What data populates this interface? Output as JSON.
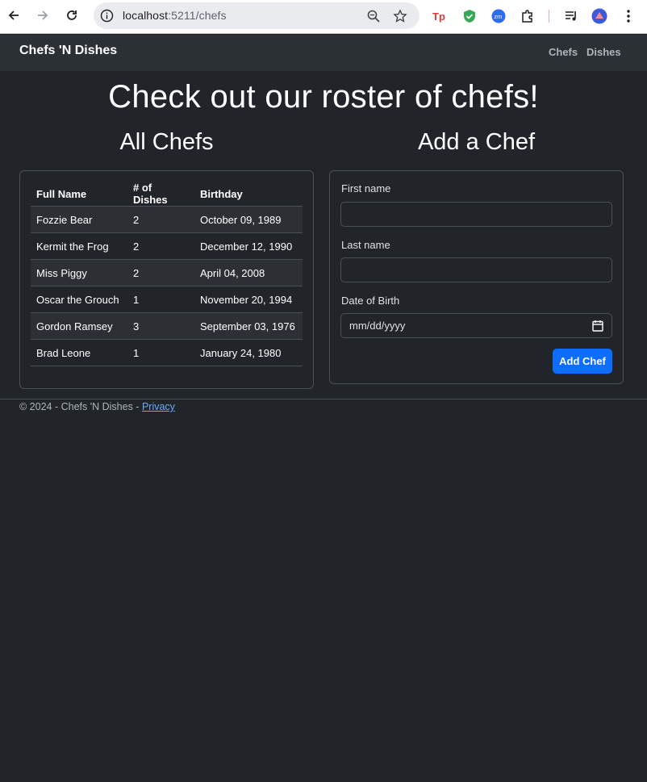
{
  "browser": {
    "url_host": "localhost",
    "url_path": ":5211/chefs"
  },
  "navbar": {
    "brand": "Chefs 'N Dishes",
    "links": [
      "Chefs",
      "Dishes"
    ]
  },
  "page": {
    "title": "Check out our roster of chefs!"
  },
  "chefs_section": {
    "title": "All Chefs",
    "columns": [
      "Full Name",
      "# of Dishes",
      "Birthday"
    ],
    "rows": [
      [
        "Fozzie Bear",
        "2",
        "October 09, 1989"
      ],
      [
        "Kermit the Frog",
        "2",
        "December 12, 1990"
      ],
      [
        "Miss Piggy",
        "2",
        "April 04, 2008"
      ],
      [
        "Oscar the Grouch",
        "1",
        "November 20, 1994"
      ],
      [
        "Gordon Ramsey",
        "3",
        "September 03, 1976"
      ],
      [
        "Brad Leone",
        "1",
        "January 24, 1980"
      ]
    ]
  },
  "add_chef": {
    "title": "Add a Chef",
    "first_name_label": "First name",
    "first_name_value": "",
    "last_name_label": "Last name",
    "last_name_value": "",
    "dob_label": "Date of Birth",
    "dob_placeholder": "mm/dd/yyyy",
    "submit_label": "Add Chef"
  },
  "footer": {
    "text": "© 2024 - Chefs 'N Dishes - ",
    "privacy_label": "Privacy"
  },
  "colors": {
    "background": "#212529",
    "navbar": "#2b3035",
    "primary": "#0d6efd",
    "link": "#6ea8fe"
  }
}
